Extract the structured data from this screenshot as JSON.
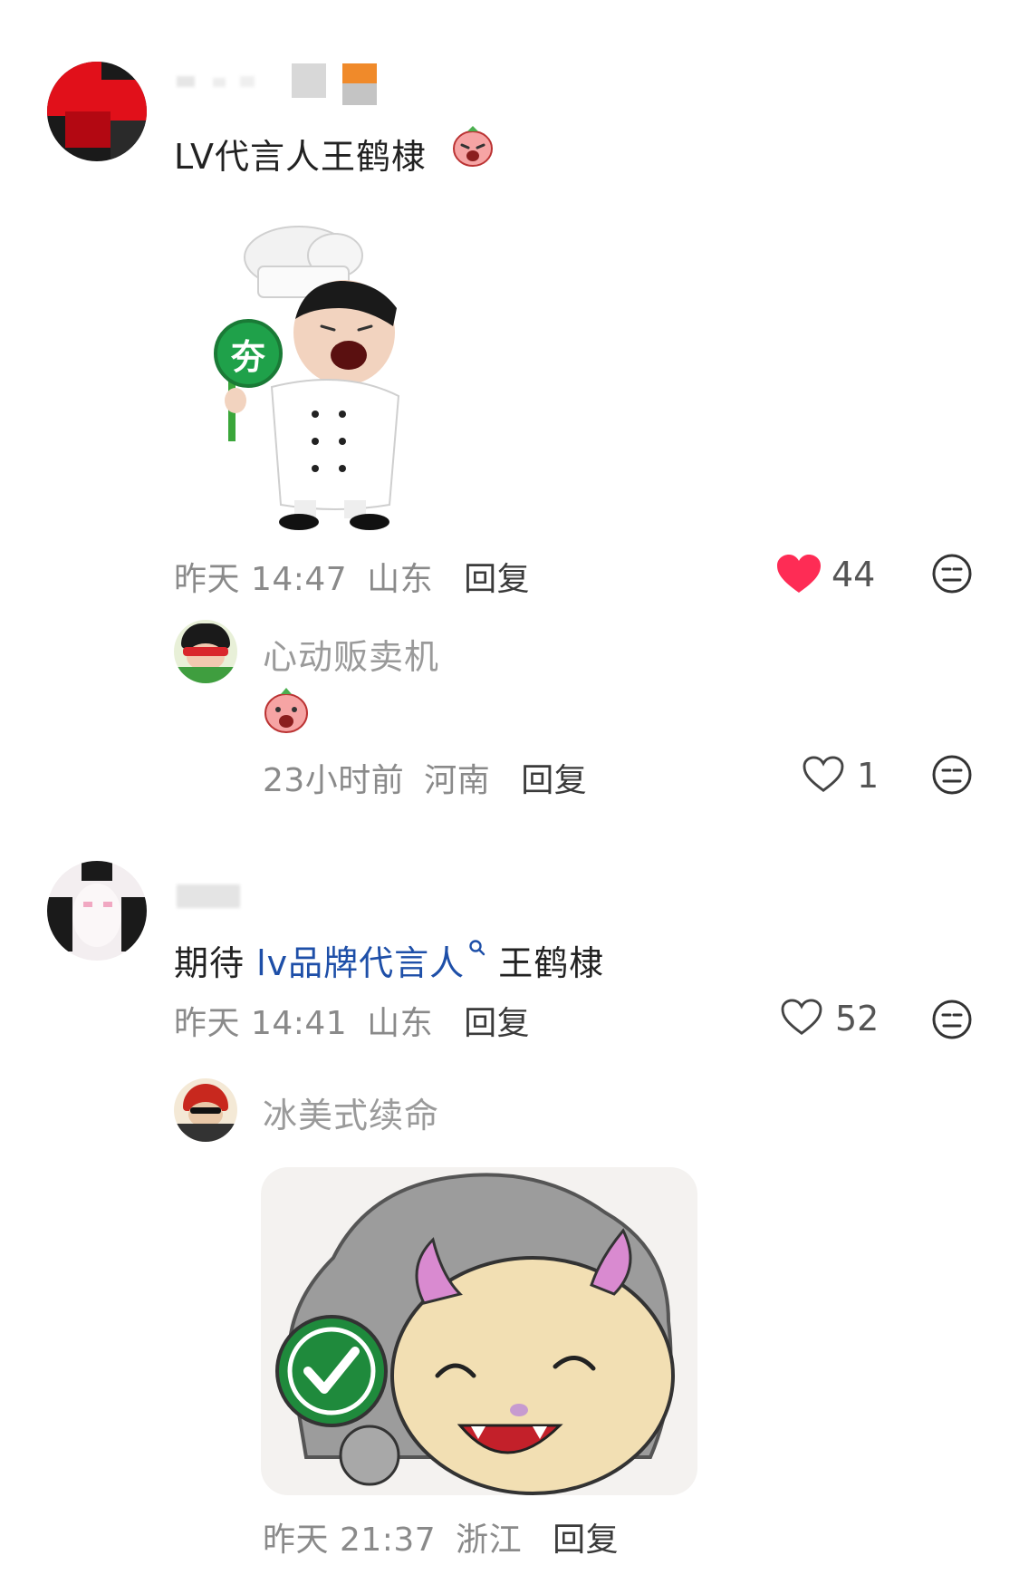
{
  "comments": [
    {
      "text": "LV代言人王鹤棣",
      "time": "昨天 14:47",
      "location": "山东",
      "reply_label": "回复",
      "likes": "44",
      "liked": true,
      "replies": [
        {
          "username": "心动贩卖机",
          "time": "23小时前",
          "location": "河南",
          "reply_label": "回复",
          "likes": "1"
        }
      ]
    },
    {
      "text_prefix": "期待 ",
      "link_text": "lv品牌代言人",
      "text_suffix": " 王鹤棣",
      "time": "昨天 14:41",
      "location": "山东",
      "reply_label": "回复",
      "likes": "52",
      "replies": [
        {
          "username": "冰美式续命",
          "time": "昨天 21:37",
          "location": "浙江",
          "reply_label": "回复"
        }
      ]
    }
  ],
  "sticker_1_badge": "夯",
  "colors": {
    "like_red": "#fe2c55",
    "link_blue": "#1e4fa8",
    "meta_gray": "#8a8a8a",
    "badge_green": "#1fa14a"
  },
  "icons": [
    "heart-filled-icon",
    "heart-outline-icon",
    "emoji-face-icon",
    "search-icon"
  ]
}
